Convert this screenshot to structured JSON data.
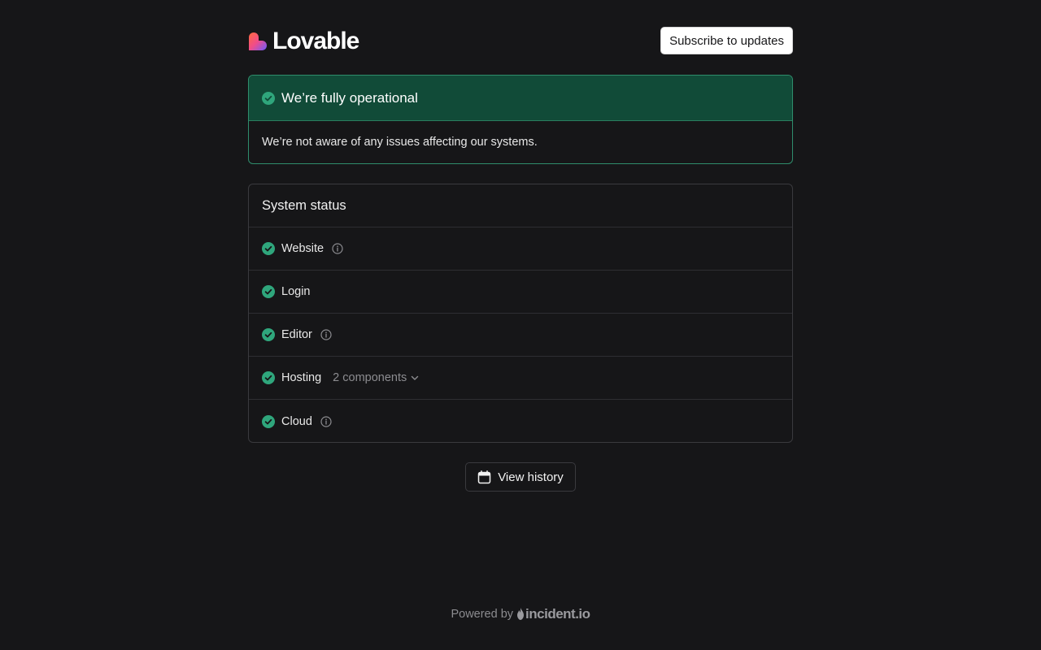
{
  "header": {
    "logo_text": "Lovable",
    "subscribe_label": "Subscribe to updates"
  },
  "banner": {
    "title": "We’re fully operational",
    "message": "We’re not aware of any issues affecting our systems.",
    "status_color": "#2fa67c"
  },
  "system_status": {
    "title": "System status",
    "components": [
      {
        "name": "Website",
        "status": "operational",
        "has_info": true
      },
      {
        "name": "Login",
        "status": "operational",
        "has_info": false
      },
      {
        "name": "Editor",
        "status": "operational",
        "has_info": true
      },
      {
        "name": "Hosting",
        "status": "operational",
        "has_info": false,
        "sub_components": "2 components"
      },
      {
        "name": "Cloud",
        "status": "operational",
        "has_info": true
      }
    ]
  },
  "history": {
    "label": "View history"
  },
  "footer": {
    "powered_by": "Powered by",
    "brand": "incident.io"
  },
  "colors": {
    "background": "#161618",
    "operational": "#2fa67c",
    "banner_bg": "#114b38"
  },
  "icons": [
    "check-circle-icon",
    "info-icon",
    "chevron-down-icon",
    "calendar-icon"
  ]
}
